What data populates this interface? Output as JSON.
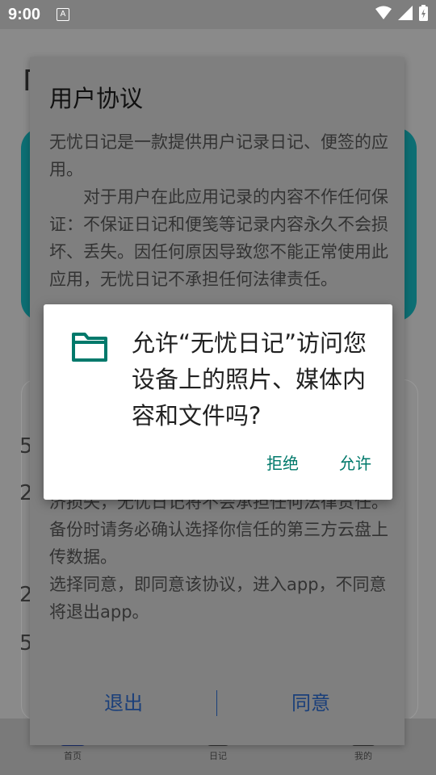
{
  "status_bar": {
    "time": "9:00",
    "notification_glyph": "A"
  },
  "app_background": {
    "title_fragment": "Г",
    "fragments": [
      "5",
      "2",
      "2",
      "5"
    ],
    "nav": [
      {
        "label": "首页",
        "icon": "home-icon"
      },
      {
        "label": "日记",
        "icon": "diary-icon"
      },
      {
        "label": "我的",
        "icon": "profile-icon"
      }
    ]
  },
  "agreement": {
    "title": "用户协议",
    "paragraph1": "无忧日记是一款提供用户记录日记、便签的应用。",
    "paragraph2": "　　对于用户在此应用记录的内容不作任何保证：不保证日记和便笺等记录内容永久不会损坏、丢失。因任何原因导致您不能正常使用此应用，无忧日记不承担任何法律责任。",
    "tail1": "济损失，无忧日记将不会承担任何法律责任。备份时请务必确认选择你信任的第三方云盘上传数据。",
    "tail2": "选择同意，即同意该协议，进入app，不同意将退出app。",
    "exit_label": "退出",
    "agree_label": "同意"
  },
  "permission": {
    "message": "允许“无忧日记”访问您设备上的照片、媒体内容和文件吗?",
    "deny_label": "拒绝",
    "allow_label": "允许",
    "icon": "folder-icon",
    "accent_color": "#00796b"
  }
}
